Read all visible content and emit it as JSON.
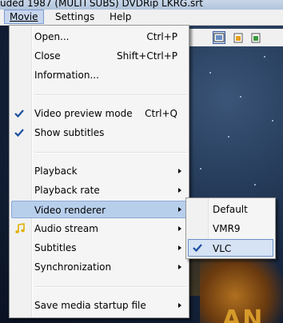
{
  "window": {
    "title": "uded 1987 (MULTI SUBS) DVDRip LKRG.srt"
  },
  "menubar": {
    "items": [
      {
        "label": "Movie",
        "active": true
      },
      {
        "label": "Settings",
        "active": false
      },
      {
        "label": "Help",
        "active": false
      }
    ]
  },
  "background": {
    "overlay_text": "AN"
  },
  "movie_menu": {
    "items": [
      {
        "label": "Open...",
        "shortcut": "Ctrl+P"
      },
      {
        "label": "Close",
        "shortcut": "Shift+Ctrl+P"
      },
      {
        "label": "Information...",
        "shortcut": ""
      },
      {
        "label": "Video preview mode",
        "shortcut": "Ctrl+Q",
        "checked": true
      },
      {
        "label": "Show subtitles",
        "shortcut": "",
        "checked": true
      },
      {
        "label": "Playback",
        "submenu": true
      },
      {
        "label": "Playback rate",
        "submenu": true
      },
      {
        "label": "Video renderer",
        "submenu": true,
        "highlighted": true
      },
      {
        "label": "Audio stream",
        "submenu": true,
        "icon": "music-note-icon"
      },
      {
        "label": "Subtitles",
        "submenu": true
      },
      {
        "label": "Synchronization",
        "submenu": true
      },
      {
        "label": "Save media startup file",
        "submenu": true
      }
    ]
  },
  "renderer_submenu": {
    "items": [
      {
        "label": "Default",
        "checked": false
      },
      {
        "label": "VMR9",
        "checked": false
      },
      {
        "label": "VLC",
        "checked": true
      }
    ]
  },
  "colors": {
    "highlight": "#b8cfec",
    "check": "#1c4ea0",
    "audio_icon": "#e0b000"
  }
}
